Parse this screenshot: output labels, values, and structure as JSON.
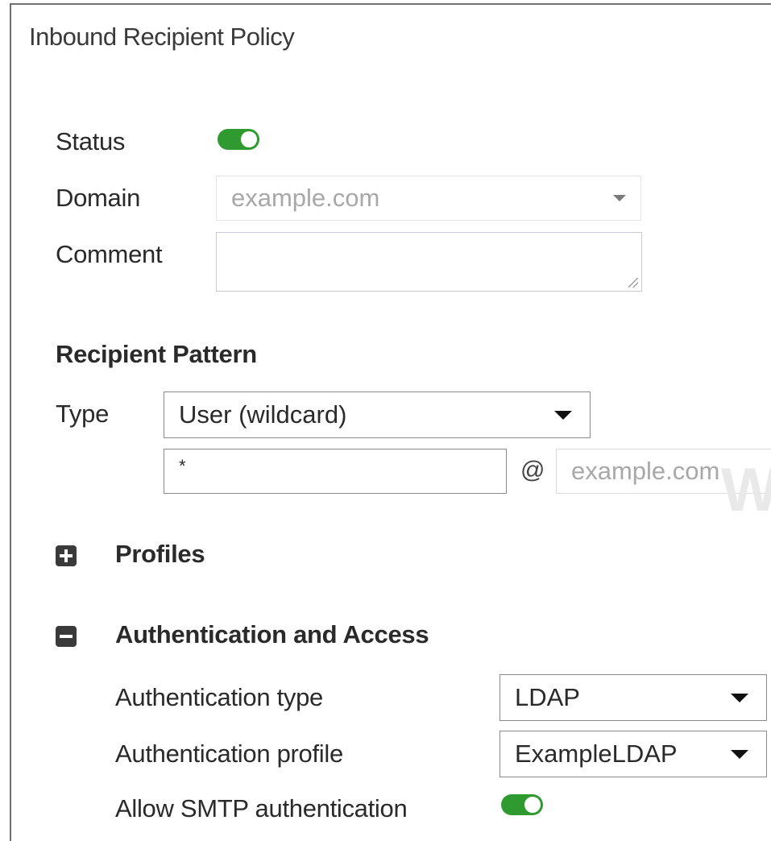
{
  "title": "Inbound Recipient Policy",
  "status": {
    "label": "Status",
    "enabled": true
  },
  "domain": {
    "label": "Domain",
    "value": "example.com"
  },
  "comment": {
    "label": "Comment",
    "value": ""
  },
  "recipient_pattern": {
    "heading": "Recipient Pattern",
    "type_label": "Type",
    "type_value": "User (wildcard)",
    "user_value": "*",
    "at_symbol": "@",
    "domain_value": "example.com"
  },
  "profiles": {
    "label": "Profiles",
    "icon": "plus-box-icon",
    "expanded": false
  },
  "auth": {
    "label": "Authentication and Access",
    "icon": "minus-box-icon",
    "expanded": true,
    "type_label": "Authentication type",
    "type_value": "LDAP",
    "profile_label": "Authentication profile",
    "profile_value": "ExampleLDAP",
    "smtp_label": "Allow SMTP authentication",
    "smtp_enabled": true
  },
  "colors": {
    "toggle_on": "#2f9a2f",
    "icon_dark": "#3a3a3a"
  }
}
